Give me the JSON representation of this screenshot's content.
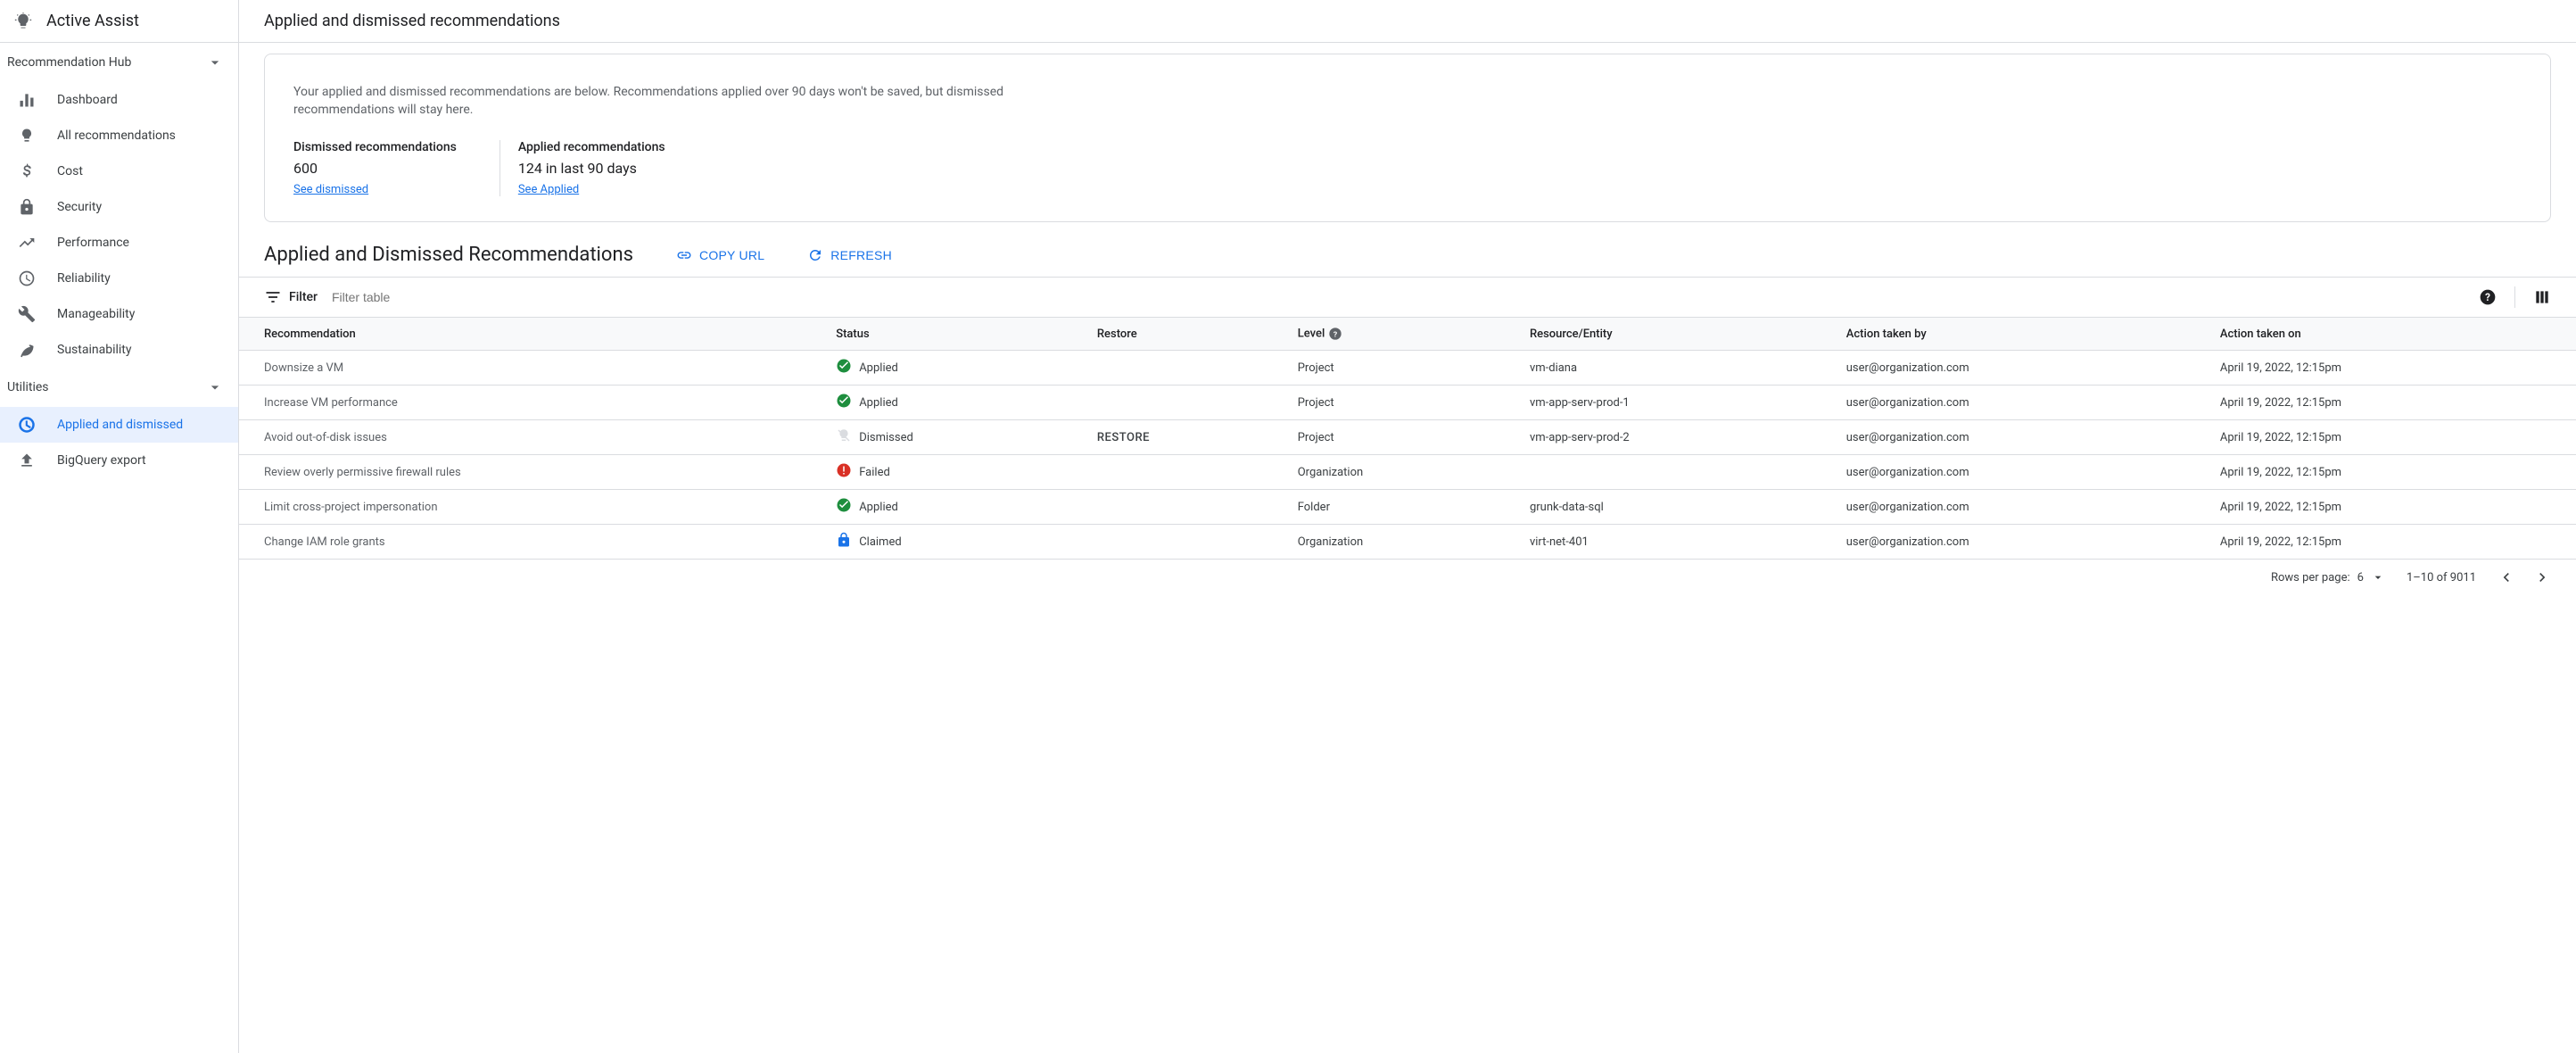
{
  "app_name": "Active Assist",
  "page_title": "Applied and dismissed recommendations",
  "sidebar": {
    "sections": {
      "hub": {
        "label": "Recommendation Hub",
        "items": [
          {
            "label": "Dashboard"
          },
          {
            "label": "All recommendations"
          },
          {
            "label": "Cost"
          },
          {
            "label": "Security"
          },
          {
            "label": "Performance"
          },
          {
            "label": "Reliability"
          },
          {
            "label": "Manageability"
          },
          {
            "label": "Sustainability"
          }
        ]
      },
      "utilities": {
        "label": "Utilities",
        "items": [
          {
            "label": "Applied and dismissed"
          },
          {
            "label": "BigQuery export"
          }
        ]
      }
    }
  },
  "summary": {
    "description": "Your applied and dismissed recommendations are below. Recommendations applied over 90 days won't be saved, but dismissed recommendations will stay here.",
    "dismissed": {
      "label": "Dismissed recommendations",
      "value": "600",
      "link": "See dismissed"
    },
    "applied": {
      "label": "Applied recommendations",
      "value": "124 in last 90 days",
      "link": "See Applied"
    }
  },
  "section": {
    "title": "Applied and Dismissed Recommendations",
    "copy_url": "COPY URL",
    "refresh": "REFRESH"
  },
  "filter": {
    "label": "Filter",
    "placeholder": "Filter table"
  },
  "table": {
    "headers": {
      "recommendation": "Recommendation",
      "status": "Status",
      "restore": "Restore",
      "level": "Level",
      "resource": "Resource/Entity",
      "action_by": "Action taken by",
      "action_on": "Action taken on"
    },
    "rows": [
      {
        "recommendation": "Downsize a VM",
        "status": "Applied",
        "status_icon": "check",
        "restore": "",
        "level": "Project",
        "resource": "vm-diana",
        "action_by": "user@organization.com",
        "action_on": "April 19, 2022, 12:15pm"
      },
      {
        "recommendation": "Increase VM performance",
        "status": "Applied",
        "status_icon": "check",
        "restore": "",
        "level": "Project",
        "resource": "vm-app-serv-prod-1",
        "action_by": "user@organization.com",
        "action_on": "April 19, 2022, 12:15pm"
      },
      {
        "recommendation": "Avoid out-of-disk issues",
        "status": "Dismissed",
        "status_icon": "dismissed",
        "restore": "RESTORE",
        "level": "Project",
        "resource": "vm-app-serv-prod-2",
        "action_by": "user@organization.com",
        "action_on": "April 19, 2022, 12:15pm"
      },
      {
        "recommendation": "Review overly permissive firewall rules",
        "status": "Failed",
        "status_icon": "error",
        "restore": "",
        "level": "Organization",
        "resource": "",
        "action_by": "user@organization.com",
        "action_on": "April 19, 2022, 12:15pm"
      },
      {
        "recommendation": "Limit cross-project impersonation",
        "status": "Applied",
        "status_icon": "check",
        "restore": "",
        "level": "Folder",
        "resource": "grunk-data-sql",
        "action_by": "user@organization.com",
        "action_on": "April 19, 2022, 12:15pm"
      },
      {
        "recommendation": "Change IAM role grants",
        "status": "Claimed",
        "status_icon": "lock",
        "restore": "",
        "level": "Organization",
        "resource": "virt-net-401",
        "action_by": "user@organization.com",
        "action_on": "April 19, 2022, 12:15pm"
      }
    ]
  },
  "pagination": {
    "rows_label": "Rows per page:",
    "rows_value": "6",
    "range": "1–10 of 9011"
  }
}
